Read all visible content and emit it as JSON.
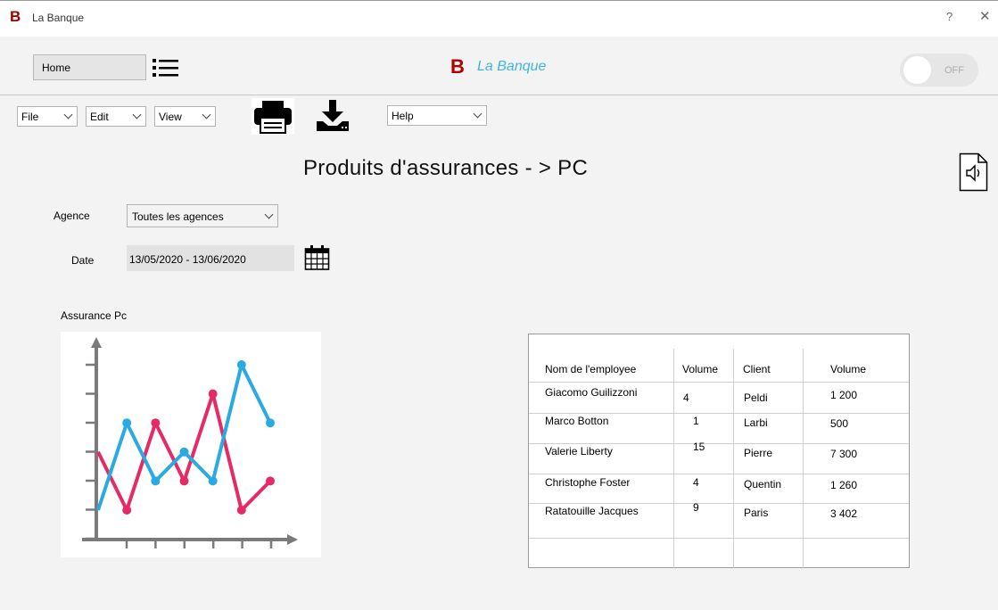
{
  "window": {
    "logo": "B",
    "title": "La Banque",
    "help": "?",
    "close": "✕"
  },
  "header": {
    "home_label": "Home",
    "brand_letter": "B",
    "brand_name": "La Banque",
    "toggle_label": "OFF"
  },
  "menubar": {
    "file": "File",
    "edit": "Edit",
    "view": "View",
    "help": "Help"
  },
  "page": {
    "heading": "Produits d'assurances - > PC"
  },
  "filters": {
    "agence_label": "Agence",
    "agence_value": "Toutes les agences",
    "date_label": "Date",
    "date_value": "13/05/2020 - 13/06/2020"
  },
  "chart": {
    "title": "Assurance Pc"
  },
  "chart_data": {
    "type": "line",
    "title": "Assurance Pc",
    "x": [
      1,
      2,
      3,
      4,
      5,
      6,
      7
    ],
    "series": [
      {
        "color": "#29abe2",
        "values": [
          1,
          4,
          2,
          3,
          2,
          6,
          4
        ]
      },
      {
        "color": "#e52a66",
        "values": [
          3,
          1,
          4,
          2,
          5,
          1,
          2
        ]
      }
    ],
    "grid": false
  },
  "table": {
    "headers": [
      "Nom de l'employee",
      "Volume",
      "Client",
      "Volume"
    ],
    "rows": [
      [
        "Giacomo Guilizzoni",
        "4",
        "Peldi",
        "1 200"
      ],
      [
        "Marco Botton",
        "1",
        "Larbi",
        "500"
      ],
      [
        "Valerie Liberty",
        "15",
        "Pierre",
        "7 300"
      ],
      [
        "Christophe Foster",
        "4",
        "Quentin",
        "1 260"
      ],
      [
        "Ratatouille Jacques",
        "9",
        "Paris",
        "3 402"
      ]
    ]
  },
  "colors": {
    "brand_red": "#b00000",
    "brand_blue": "#3fb6e0",
    "series_blue": "#29abe2",
    "series_pink": "#e52a66"
  }
}
